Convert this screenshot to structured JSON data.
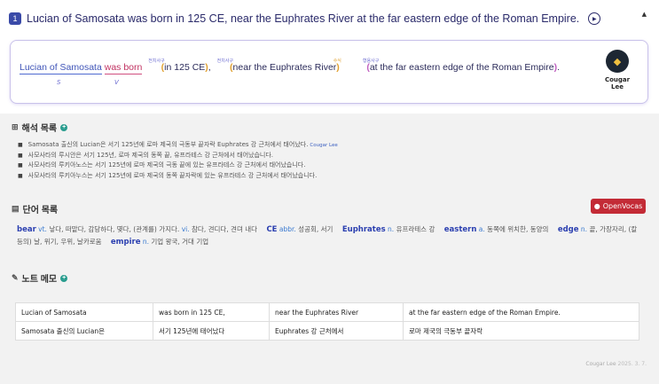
{
  "title": {
    "number": "1",
    "text": "Lucian of Samosata was born in 125 CE, near the Euphrates River at the far eastern edge of the Roman Empire."
  },
  "sentence": {
    "subject": "Lucian of Samosata",
    "verb": "was born",
    "phrase1": "in 125 CE",
    "phrase2": "near the Euphrates River",
    "phrase3": "at the far eastern edge of the Roman Empire",
    "tag1": "전치사구",
    "tag2": "전치사구",
    "tag3": "수식",
    "tag4": "형용사구",
    "label_s": "S",
    "label_v": "V"
  },
  "user": {
    "name": "Cougar Lee"
  },
  "translations": {
    "heading": "해석 목록",
    "items": [
      "Samosata 출신의 Lucian은 서기 125년에 로마 제국의 극동부 끝자락 Euphrates 강 근처에서 태어났다.",
      "사모사타의 루시안은 서기 125년, 로마 제국의 동쪽 끝, 유프라테스 강 근처에서 태어났습니다.",
      "사모사타의 루키아노스는 서기 125년에 로마 제국의 극동 끝에 있는 유프라테스 강 근처에서 태어났습니다.",
      "사모사타의 루키아누스는 서기 125년에 로마 제국의 동쪽 끝자락에 있는 유프라테스 강 근처에서 태어났습니다."
    ],
    "item1_author": "Cougar Lee"
  },
  "vocab": {
    "heading": "단어 목록",
    "button": "OpenVocas",
    "entries": [
      {
        "word": "bear",
        "pos": "vt.",
        "meaning": "낳다, 떠맡다, 감당하다, 몇다, (관계를) 가지다.",
        "pos2": "vi.",
        "meaning2": "참다, 견디다, 견뎌 내다"
      },
      {
        "word": "CE",
        "pos": "abbr.",
        "meaning": "성공회, 서기"
      },
      {
        "word": "Euphrates",
        "pos": "n.",
        "meaning": "유프라테스 강"
      },
      {
        "word": "eastern",
        "pos": "a.",
        "meaning": "동쪽에 위치한, 동양의"
      },
      {
        "word": "edge",
        "pos": "n.",
        "meaning": "끝, 가장자리, (칼 등의) 날, 위기, 우위, 날카로움"
      },
      {
        "word": "empire",
        "pos": "n.",
        "meaning": "기업 왕국, 거대 기업"
      }
    ]
  },
  "notes": {
    "heading": "노트 메모",
    "rows": [
      [
        "Lucian of Samosata",
        "was born in 125 CE,",
        "near the Euphrates River",
        "at the far eastern edge of the Roman Empire."
      ],
      [
        "Samosata 출신의 Lucian은",
        "서기 125년에 태어났다",
        "Euphrates 강 근처에서",
        "로마 제국의 극동부 끝자락"
      ]
    ],
    "author": "Cougar Lee",
    "date": "2025. 3. 7."
  }
}
